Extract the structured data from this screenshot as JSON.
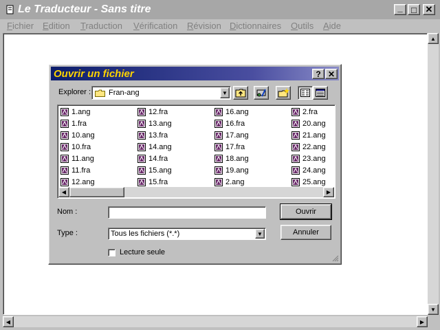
{
  "app": {
    "title": "Le Traducteur - Sans titre",
    "controls": {
      "minimize": "_",
      "maximize": "□",
      "close": "✕"
    }
  },
  "menu": [
    "Fichier",
    "Edition",
    "Traduction",
    "Vérification",
    "Révision",
    "Dictionnaires",
    "Outils",
    "Aide"
  ],
  "dialog": {
    "title": "Ouvrir un fichier",
    "help_glyph": "?",
    "close_glyph": "✕",
    "explorer_label": "Explorer :",
    "current_folder": "Fran-ang",
    "toolbar_icons": [
      "up-one-level-icon",
      "network-drive-icon",
      "new-folder-icon",
      "list-view-icon",
      "details-view-icon"
    ],
    "files": [
      [
        "1.ang",
        "1.fra",
        "10.ang",
        "10.fra",
        "11.ang",
        "11.fra",
        "12.ang"
      ],
      [
        "12.fra",
        "13.ang",
        "13.fra",
        "14.ang",
        "14.fra",
        "15.ang",
        "15.fra"
      ],
      [
        "16.ang",
        "16.fra",
        "17.ang",
        "17.fra",
        "18.ang",
        "19.ang",
        "2.ang"
      ],
      [
        "2.fra",
        "20.ang",
        "21.ang",
        "22.ang",
        "23.ang",
        "24.ang",
        "25.ang"
      ]
    ],
    "name_label": "Nom :",
    "name_value": "",
    "type_label": "Type :",
    "type_value": "Tous les fichiers (*.*)",
    "open_button": "Ouvrir",
    "cancel_button": "Annuler",
    "readonly_label": "Lecture seule",
    "readonly_checked": false
  },
  "colors": {
    "dialog_title_gradient_start": "#0c1d6b",
    "dialog_title_text": "#ffd400",
    "inactive_title": "#a7a7a7",
    "face": "#c0c0c0"
  }
}
